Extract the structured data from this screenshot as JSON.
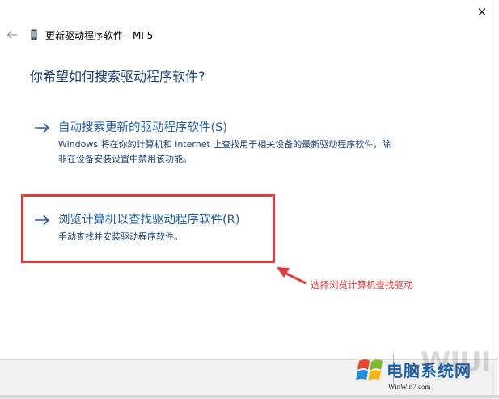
{
  "window": {
    "title": "更新驱动程序软件 - MI 5",
    "close_glyph": "✕",
    "back_glyph": "←"
  },
  "heading": "你希望如何搜索驱动程序软件?",
  "options": [
    {
      "title": "自动搜索更新的驱动程序软件(S)",
      "desc": "Windows 将在你的计算机和 Internet 上查找用于相关设备的最新驱动程序软件，除非在设备安装设置中禁用该功能。"
    },
    {
      "title": "浏览计算机以查找驱动程序软件(R)",
      "desc": "手动查找并安装驱动程序软件。"
    }
  ],
  "annotation": {
    "text": "选择浏览计算机查找驱动",
    "color": "#e23b3b"
  },
  "watermark": {
    "letters": "WIUI",
    "brand": "电脑系统网",
    "sub": "WinWin7.com"
  },
  "colors": {
    "heading": "#1a3e73",
    "link": "#1f5fa8",
    "highlight": "#e23b3b"
  }
}
